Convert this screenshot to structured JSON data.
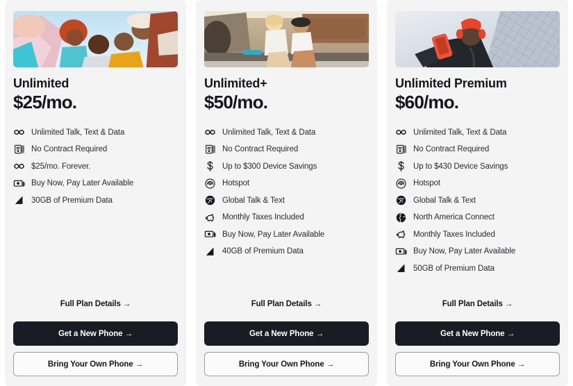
{
  "cards": [
    {
      "hero_icon": "friends-group-photo",
      "name": "Unlimited",
      "price": "$25/mo.",
      "features": [
        {
          "icon": "infinity-icon",
          "label": "Unlimited Talk, Text & Data"
        },
        {
          "icon": "contract-icon",
          "label": "No Contract Required"
        },
        {
          "icon": "infinity-icon",
          "label": "$25/mo. Forever."
        },
        {
          "icon": "money-icon",
          "label": "Buy Now, Pay Later Available"
        },
        {
          "icon": "signal-icon",
          "label": "30GB of Premium Data"
        }
      ],
      "details_label": "Full Plan Details  →",
      "primary_label": "Get a New Phone  →",
      "secondary_label": "Bring Your Own Phone  →"
    },
    {
      "hero_icon": "two-women-skatepark-photo",
      "name": "Unlimited+",
      "price": "$50/mo.",
      "features": [
        {
          "icon": "infinity-icon",
          "label": "Unlimited Talk, Text & Data"
        },
        {
          "icon": "contract-icon",
          "label": "No Contract Required"
        },
        {
          "icon": "dollar-icon",
          "label": "Up to $300 Device Savings"
        },
        {
          "icon": "hotspot-icon",
          "label": "Hotspot"
        },
        {
          "icon": "globe-icon",
          "label": "Global Talk & Text"
        },
        {
          "icon": "piggy-bank-icon",
          "label": "Monthly Taxes Included"
        },
        {
          "icon": "money-icon",
          "label": "Buy Now, Pay Later Available"
        },
        {
          "icon": "signal-icon",
          "label": "40GB of Premium Data"
        }
      ],
      "details_label": "Full Plan Details  →",
      "primary_label": "Get a New Phone  →",
      "secondary_label": "Bring Your Own Phone  →"
    },
    {
      "hero_icon": "man-selfie-phone-photo",
      "name": "Unlimited Premium",
      "price": "$60/mo.",
      "features": [
        {
          "icon": "infinity-icon",
          "label": "Unlimited Talk, Text & Data"
        },
        {
          "icon": "contract-icon",
          "label": "No Contract Required"
        },
        {
          "icon": "dollar-icon",
          "label": "Up to $430 Device Savings"
        },
        {
          "icon": "hotspot-icon",
          "label": "Hotspot"
        },
        {
          "icon": "globe-icon",
          "label": "Global Talk & Text"
        },
        {
          "icon": "globe-americas-icon",
          "label": "North America Connect"
        },
        {
          "icon": "piggy-bank-icon",
          "label": "Monthly Taxes Included"
        },
        {
          "icon": "money-icon",
          "label": "Buy Now, Pay Later Available"
        },
        {
          "icon": "signal-icon",
          "label": "50GB of Premium Data"
        }
      ],
      "details_label": "Full Plan Details  →",
      "primary_label": "Get a New Phone  →",
      "secondary_label": "Bring Your Own Phone  →"
    }
  ],
  "colors": {
    "card_background": "#f4f4f5",
    "page_background": "#ffffff",
    "text_primary": "#16161a",
    "primary_button": "#1b1b25",
    "secondary_button_border": "#9c9ca2"
  }
}
